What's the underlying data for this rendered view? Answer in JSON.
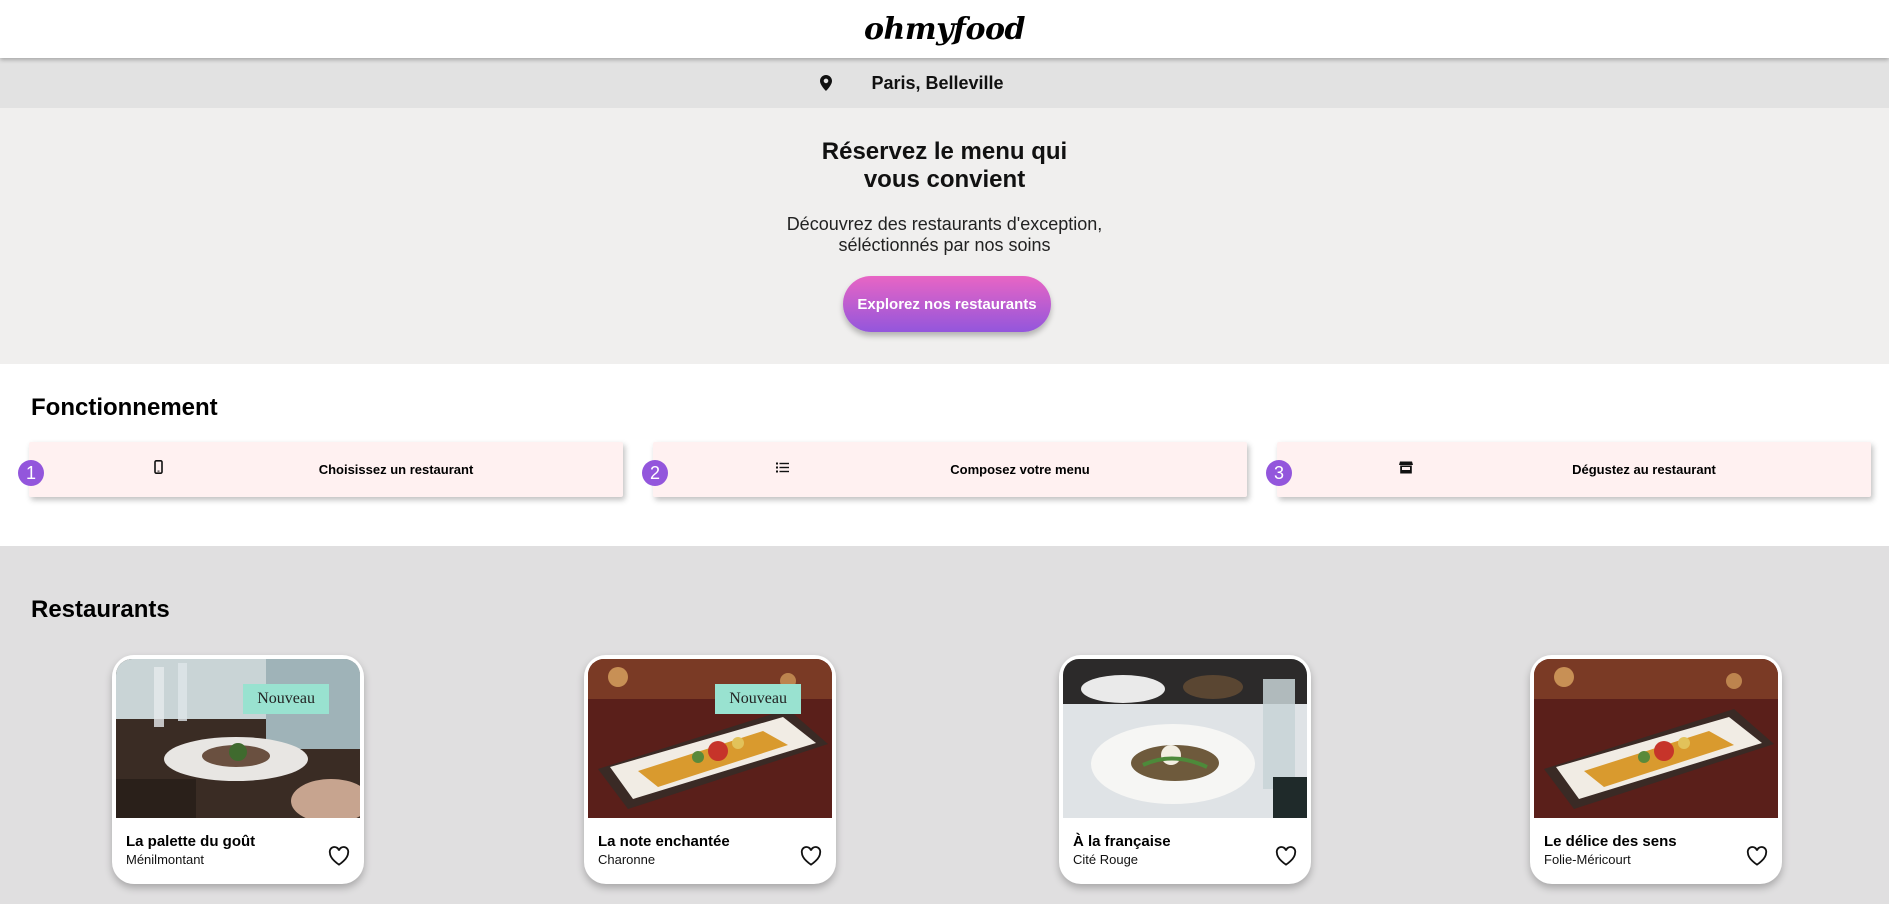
{
  "header": {
    "logo": "ohmyfood"
  },
  "location": {
    "icon": "map-pin-icon",
    "label": "Paris, Belleville"
  },
  "hero": {
    "title_line1": "Réservez le menu qui",
    "title_line2": "vous convient",
    "subtitle_line1": "Découvrez des restaurants d'exception,",
    "subtitle_line2": "séléctionnés par nos soins",
    "cta_label": "Explorez nos restaurants"
  },
  "how": {
    "title": "Fonctionnement",
    "steps": [
      {
        "number": "1",
        "icon": "mobile-phone-icon",
        "label": "Choisissez un restaurant"
      },
      {
        "number": "2",
        "icon": "list-icon",
        "label": "Composez votre menu"
      },
      {
        "number": "3",
        "icon": "store-icon",
        "label": "Dégustez au restaurant"
      }
    ]
  },
  "restaurants": {
    "title": "Restaurants",
    "cards": [
      {
        "name": "La palette du goût",
        "area": "Ménilmontant",
        "badge": "Nouveau"
      },
      {
        "name": "La note enchantée",
        "area": "Charonne",
        "badge": "Nouveau"
      },
      {
        "name": "À la française",
        "area": "Cité Rouge",
        "badge": ""
      },
      {
        "name": "Le délice des sens",
        "area": "Folie-Méricourt",
        "badge": ""
      }
    ]
  },
  "colors": {
    "accent_start": "#e865c4",
    "accent_end": "#9356dc",
    "badge": "#99e2d0",
    "step_bg": "#fff1f1"
  }
}
